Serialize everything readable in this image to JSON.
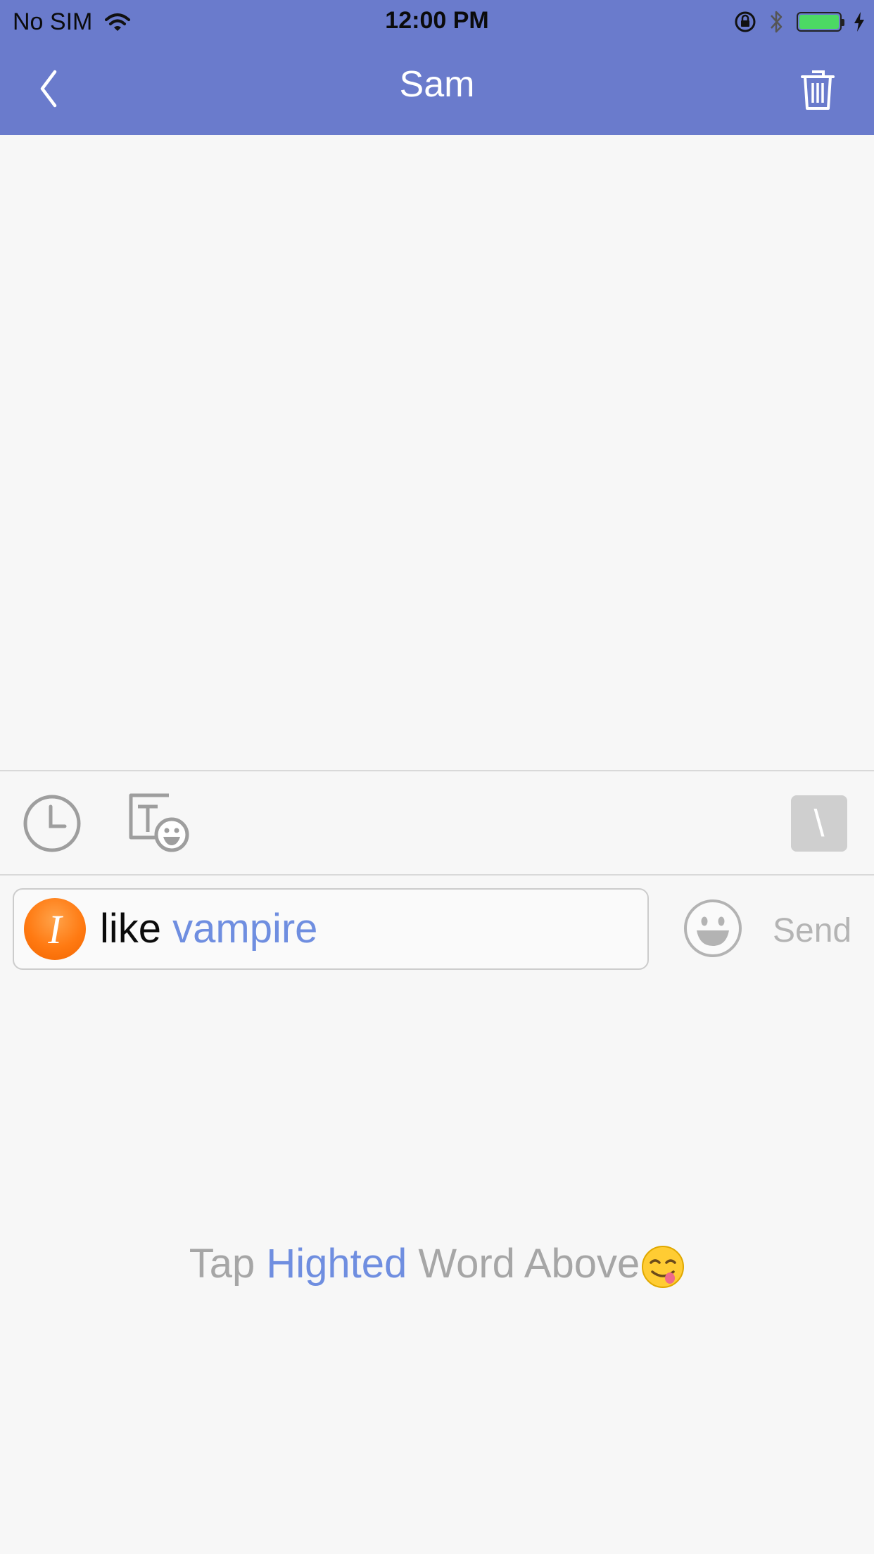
{
  "status_bar": {
    "carrier": "No SIM",
    "time": "12:00 PM",
    "battery_color": "#4cd964"
  },
  "nav": {
    "title": "Sam",
    "back_icon": "chevron-left-icon",
    "trash_icon": "trash-icon",
    "background": "#6a7bcc"
  },
  "toolbar": {
    "history_icon": "clock-icon",
    "text_emoji_icon": "text-emoji-icon",
    "toggle_label": "\\"
  },
  "composer": {
    "badge_letter": "I",
    "text_plain": "like ",
    "text_highlight": "vampire",
    "emoji_icon": "smiley-icon",
    "send_label": "Send"
  },
  "hint": {
    "part1": "Tap ",
    "highlight": "Highted",
    "part2": " Word Above",
    "emoji_icon": "yum-face-icon",
    "highlight_color": "#6f8ee0"
  }
}
